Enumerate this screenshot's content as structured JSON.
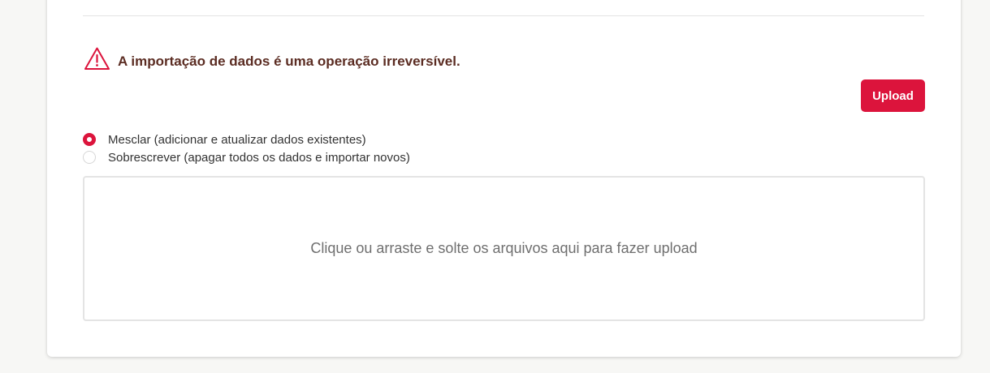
{
  "warning": {
    "icon": "warning-triangle-icon",
    "text": "A importação de dados é uma operação irreversível.",
    "color": "#dc143c"
  },
  "upload_button": {
    "label": "Upload",
    "color": "#dc143c"
  },
  "import_mode": {
    "selected": "merge",
    "options": [
      {
        "id": "merge",
        "label": "Mesclar (adicionar e atualizar dados existentes)",
        "checked": true
      },
      {
        "id": "overwrite",
        "label": "Sobrescrever (apagar todos os dados e importar novos)",
        "checked": false
      }
    ]
  },
  "dropzone": {
    "text": "Clique ou arraste e solte os arquivos aqui para fazer upload"
  }
}
